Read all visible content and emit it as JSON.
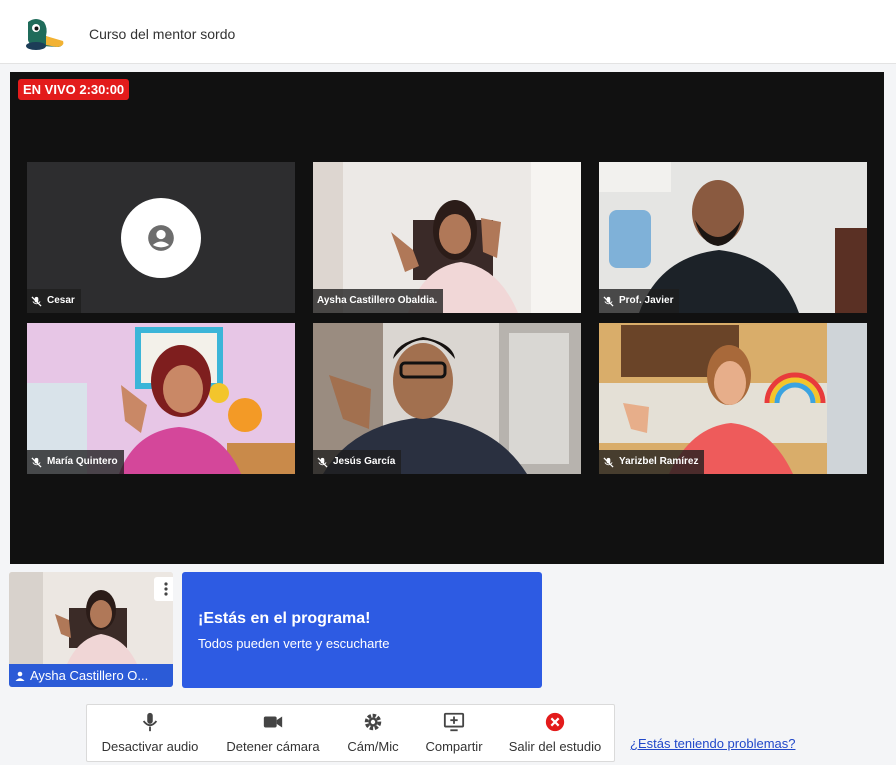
{
  "header": {
    "title": "Curso del mentor sordo",
    "logo_icon": "duck-logo-icon"
  },
  "stage": {
    "live_badge": "EN VIVO 2:30:00",
    "tiles": [
      {
        "name": "Cesar",
        "video": false
      },
      {
        "name": "Aysha Castillero Obaldia.",
        "video": true
      },
      {
        "name": "Prof. Javier",
        "video": true
      },
      {
        "name": "María Quintero",
        "video": true
      },
      {
        "name": "Jesús García",
        "video": true
      },
      {
        "name": "Yarizbel Ramírez",
        "video": true
      }
    ]
  },
  "self_view": {
    "name": "Aysha Castillero O..."
  },
  "banner": {
    "heading": "¡Estás en el programa!",
    "subtitle": "Todos pueden verte y escucharte"
  },
  "controls": [
    {
      "label": "Desactivar audio",
      "icon": "microphone-icon"
    },
    {
      "label": "Detener cámara",
      "icon": "camera-icon"
    },
    {
      "label": "Cám/Mic",
      "icon": "gear-icon"
    },
    {
      "label": "Compartir",
      "icon": "screen-share-icon"
    },
    {
      "label": "Salir del estudio",
      "icon": "exit-icon"
    }
  ],
  "help_link": "¿Estás teniendo problemas?",
  "colors": {
    "live": "#e31b1b",
    "accent": "#2d5be3",
    "exit": "#e31b1b",
    "stage": "#111111"
  }
}
